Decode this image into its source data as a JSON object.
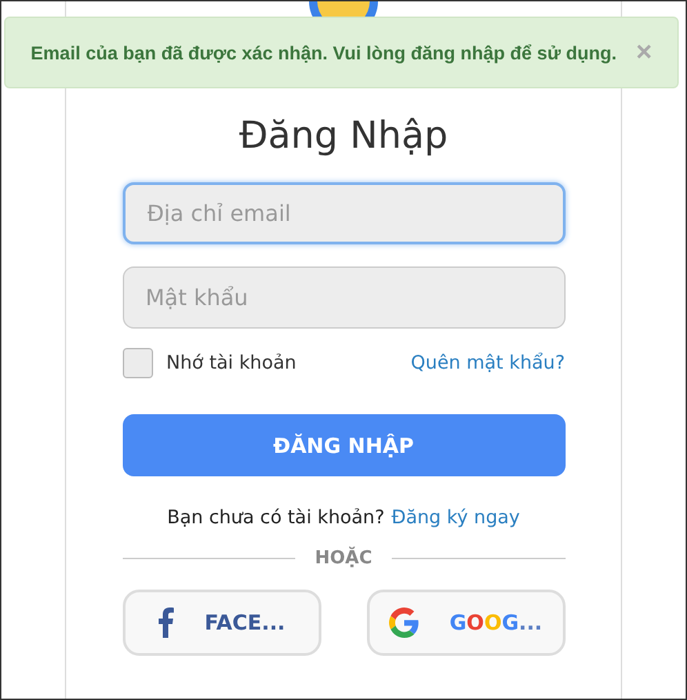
{
  "alert": {
    "message": "Email của bạn đã được xác nhận. Vui lòng đăng nhập để sử dụng.",
    "close": "×"
  },
  "title": "Đăng Nhập",
  "fields": [
    {
      "placeholder": "Địa chỉ email",
      "focused": true
    },
    {
      "placeholder": "Mật khẩu",
      "focused": false
    }
  ],
  "remember": {
    "label": "Nhớ tài khoản",
    "checked": false
  },
  "forgot_link": "Quên mật khẩu?",
  "submit": "ĐĂNG NHẬP",
  "signup": {
    "text": "Bạn chưa có tài khoản?",
    "link": "Đăng ký ngay"
  },
  "divider": "HOẶC",
  "social": [
    {
      "kind": "facebook",
      "label": "FACE..."
    },
    {
      "kind": "google",
      "label": "GOOG..."
    }
  ]
}
